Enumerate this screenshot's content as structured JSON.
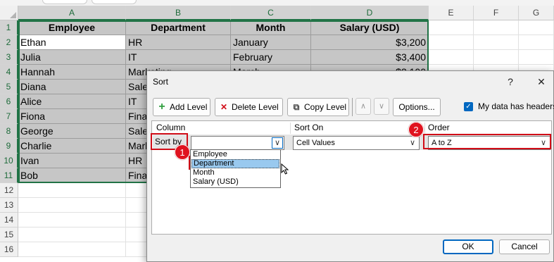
{
  "sheet": {
    "columns": [
      "A",
      "B",
      "C",
      "D",
      "E",
      "F",
      "G"
    ],
    "rows": [
      "1",
      "2",
      "3",
      "4",
      "5",
      "6",
      "7",
      "8",
      "9",
      "10",
      "11",
      "12",
      "13",
      "14",
      "15",
      "16"
    ],
    "headers": [
      "Employee",
      "Department",
      "Month",
      "Salary (USD)"
    ],
    "data": [
      [
        "Ethan",
        "HR",
        "January",
        "$3,200"
      ],
      [
        "Julia",
        "IT",
        "February",
        "$3,400"
      ],
      [
        "Hannah",
        "Marketing",
        "March",
        "$3,100"
      ],
      [
        "Diana",
        "Sale",
        "",
        ""
      ],
      [
        "Alice",
        "IT",
        "",
        ""
      ],
      [
        "Fiona",
        "Fina",
        "",
        ""
      ],
      [
        "George",
        "Sale",
        "",
        ""
      ],
      [
        "Charlie",
        "Mark",
        "",
        ""
      ],
      [
        "Ivan",
        "HR",
        "",
        ""
      ],
      [
        "Bob",
        "Fina",
        "",
        ""
      ]
    ]
  },
  "dialog": {
    "title": "Sort",
    "help": "?",
    "close": "✕",
    "toolbar": {
      "add_level": "Add Level",
      "delete_level": "Delete Level",
      "copy_level": "Copy Level",
      "move_up": "∧",
      "move_down": "∨",
      "options": "Options..."
    },
    "headers_checkbox": {
      "label": "My data has headers",
      "checked": true
    },
    "list_headers": {
      "column": "Column",
      "sort_on": "Sort On",
      "order": "Order"
    },
    "level": {
      "label": "Sort by",
      "column_value": "",
      "sort_on_value": "Cell Values",
      "order_value": "A to Z"
    },
    "dropdown_options": [
      "Employee",
      "Department",
      "Month",
      "Salary (USD)"
    ],
    "highlighted_option": "Department",
    "ok": "OK",
    "cancel": "Cancel"
  },
  "annotations": {
    "badge1": "1",
    "badge2": "2",
    "color": "#e0131f"
  }
}
